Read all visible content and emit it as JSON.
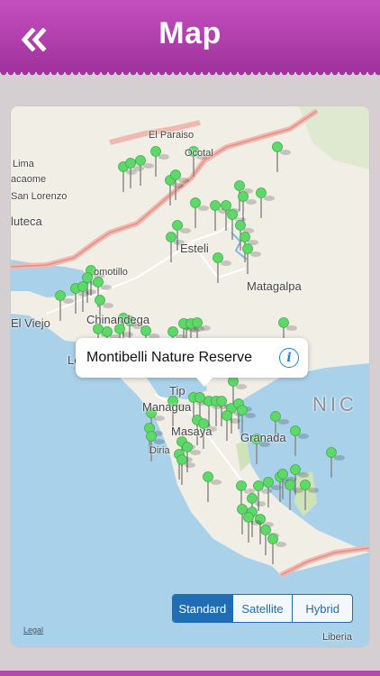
{
  "header": {
    "title": "Map",
    "back_icon": "double-chevron-left-icon"
  },
  "map": {
    "places": {
      "el_paraiso": "El Paraiso",
      "lima": "Lima",
      "yacaome": "acaome",
      "san_lorenzo": "San Lorenzo",
      "choluteca": "luteca",
      "somotillo": "omotillo",
      "esteli": "Esteli",
      "matagalpa": "Matagalpa",
      "el_viejo": "El Viejo",
      "chinandega": "Chinandega",
      "leon": "Le",
      "managua": "Managua",
      "tipitapa": "Tip",
      "masaya": "Masaya",
      "diriamba": "Diria",
      "granada": "Granada",
      "liberia": "Liberia",
      "nicaragua": "NIC",
      "ocotal": "Ocotal"
    },
    "callout": {
      "title": "Montibelli Nature Reserve",
      "icon": "info-icon"
    },
    "map_types": [
      "Standard",
      "Satellite",
      "Hybrid"
    ],
    "selected_map_type": "Standard",
    "legal": "Legal"
  },
  "colors": {
    "header": "#b03fac",
    "pin": "#5fd86a",
    "accent": "#1f6db5",
    "water": "#a9d2ea",
    "land": "#f1eee6"
  }
}
